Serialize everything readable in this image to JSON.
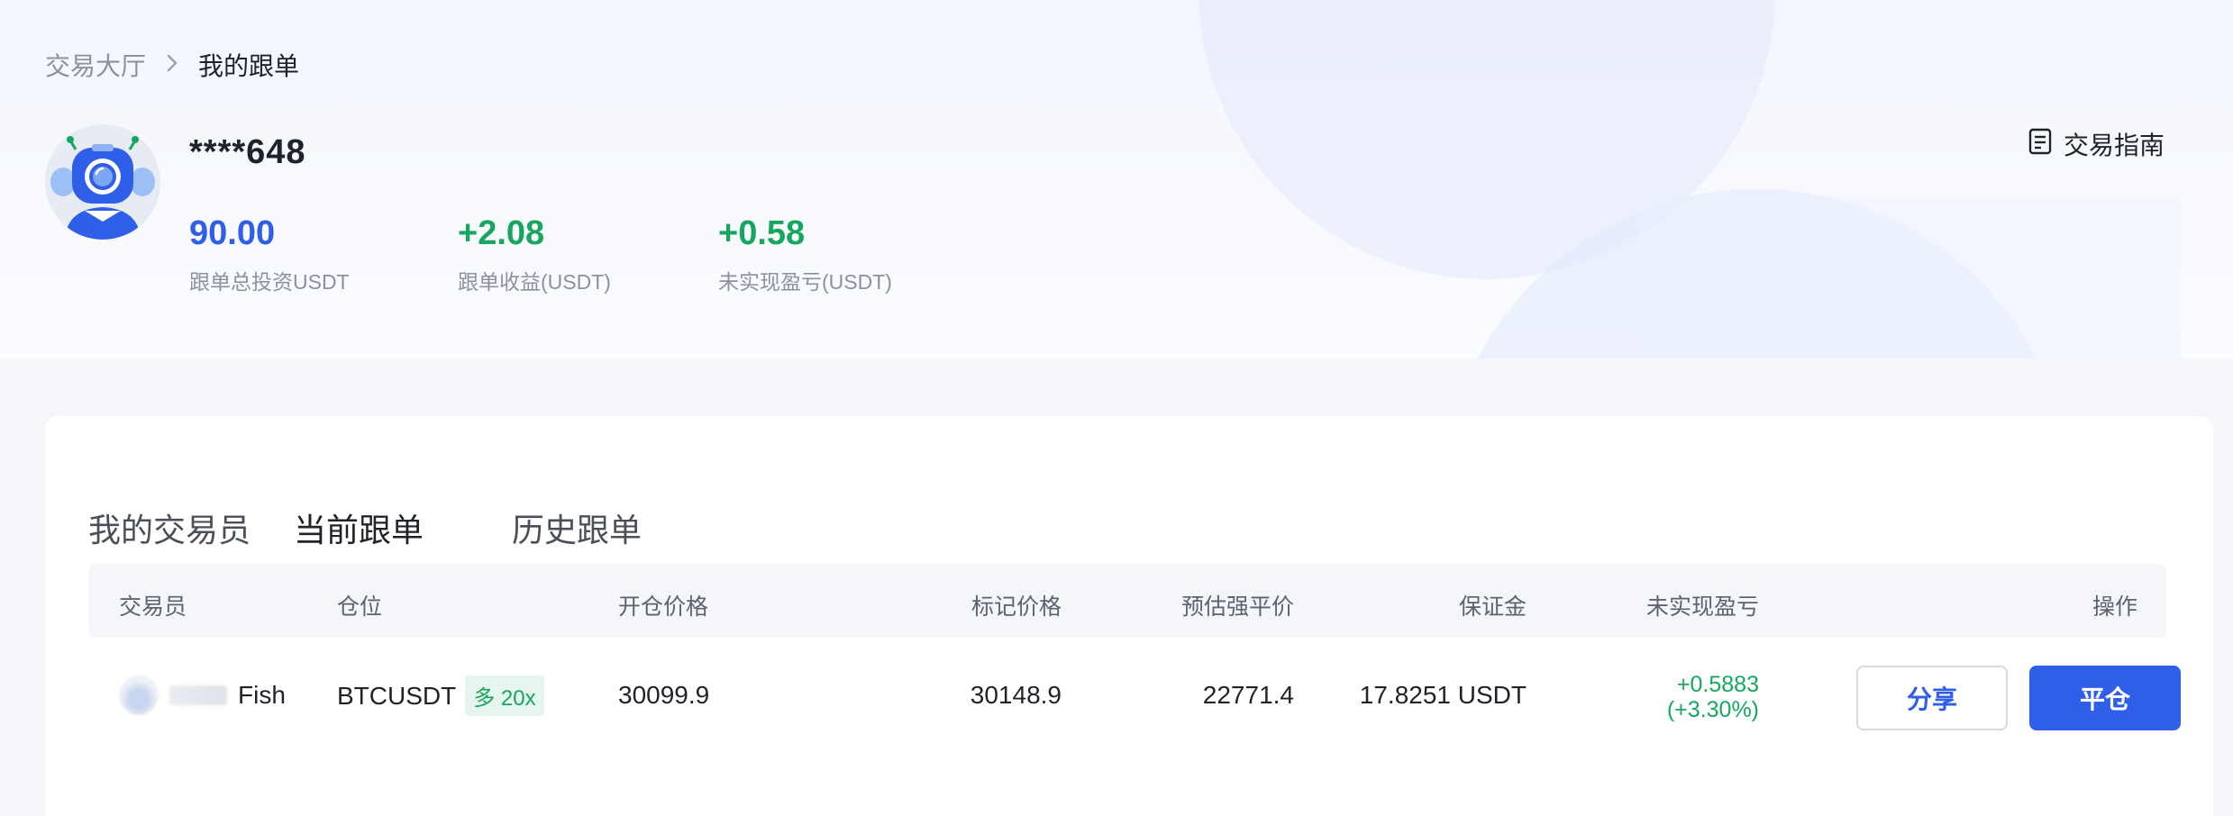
{
  "breadcrumb": {
    "parent": "交易大厅",
    "current": "我的跟单",
    "separator_icon": "chevron-right-icon"
  },
  "profile": {
    "username": "****648",
    "avatar_icon": "robot-avatar-icon"
  },
  "stats": {
    "total_investment": {
      "value": "90.00",
      "label": "跟单总投资USDT"
    },
    "copy_profit": {
      "value": "+2.08",
      "label": "跟单收益(USDT)"
    },
    "unrealized_pnl": {
      "value": "+0.58",
      "label": "未实现盈亏(USDT)"
    }
  },
  "guide": {
    "label": "交易指南",
    "icon": "document-icon"
  },
  "tabs": [
    {
      "label": "我的交易员",
      "active": false
    },
    {
      "label": "当前跟单",
      "active": true
    },
    {
      "label": "历史跟单",
      "active": false
    }
  ],
  "table": {
    "headers": {
      "trader": "交易员",
      "position": "仓位",
      "open_price": "开仓价格",
      "mark_price": "标记价格",
      "liq_price": "预估强平价",
      "margin": "保证金",
      "unrealized_pnl": "未实现盈亏",
      "action": "操作"
    },
    "rows": [
      {
        "trader": "Fish",
        "symbol": "BTCUSDT",
        "side_tag": "多 20x",
        "open_price": "30099.9",
        "mark_price": "30148.9",
        "liq_price": "22771.4",
        "margin": "17.8251 USDT",
        "pnl_value": "+0.5883",
        "pnl_percent": "(+3.30%)",
        "share_label": "分享",
        "close_label": "平仓"
      }
    ]
  },
  "colors": {
    "accent": "#2f5fe9",
    "positive": "#17a65f",
    "muted_text": "#8a919f"
  }
}
